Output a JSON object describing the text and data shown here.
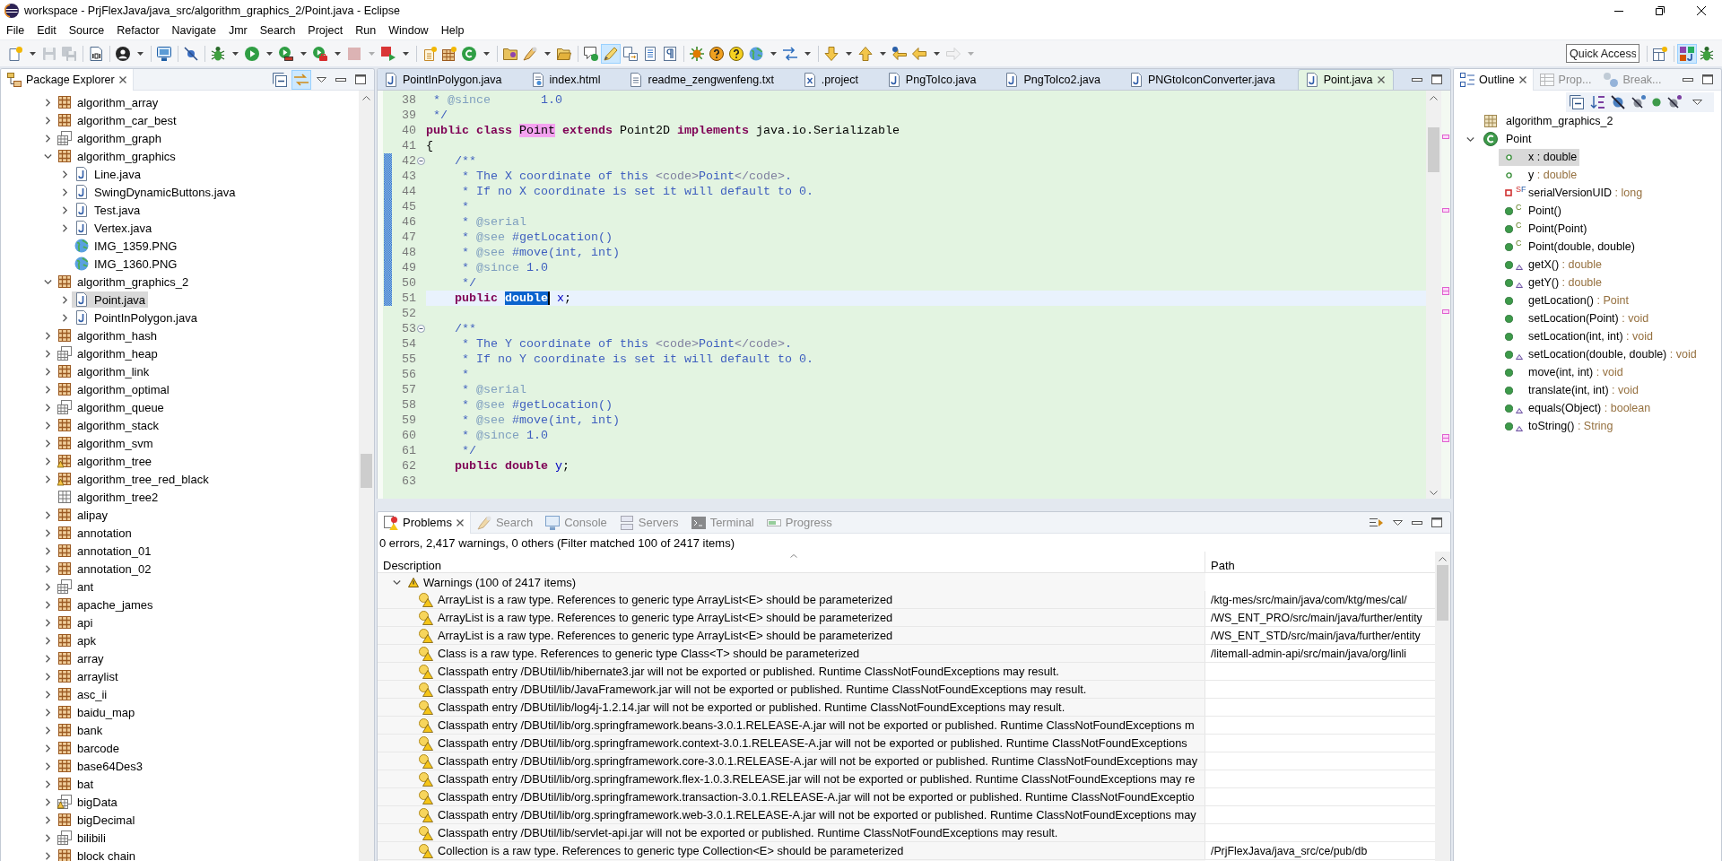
{
  "window": {
    "title": "workspace - PrjFlexJava/java_src/algorithm_graphics_2/Point.java - Eclipse"
  },
  "menu": [
    "File",
    "Edit",
    "Source",
    "Refactor",
    "Navigate",
    "Jmr",
    "Search",
    "Project",
    "Run",
    "Window",
    "Help"
  ],
  "toolbar": {
    "groups": [
      [
        {
          "kind": "new",
          "dropdown": true,
          "pressed": false,
          "disabled": false
        },
        {
          "kind": "save",
          "dropdown": false,
          "pressed": false,
          "disabled": true
        },
        {
          "kind": "save-all",
          "dropdown": false,
          "pressed": false,
          "disabled": true
        }
      ],
      [
        {
          "kind": "binary",
          "dropdown": false,
          "pressed": false,
          "disabled": false
        }
      ],
      [
        {
          "kind": "user",
          "dropdown": true,
          "pressed": false,
          "disabled": false
        }
      ],
      [
        {
          "kind": "monitor",
          "dropdown": false,
          "pressed": false,
          "disabled": false
        }
      ],
      [
        {
          "kind": "skip",
          "dropdown": false,
          "pressed": false,
          "disabled": false
        }
      ],
      [
        {
          "kind": "debug",
          "dropdown": true,
          "pressed": false,
          "disabled": false
        },
        {
          "kind": "run",
          "dropdown": true,
          "pressed": false,
          "disabled": false
        },
        {
          "kind": "coverage",
          "dropdown": true,
          "pressed": false,
          "disabled": false
        },
        {
          "kind": "tools",
          "dropdown": true,
          "pressed": false,
          "disabled": false
        },
        {
          "kind": "stop",
          "dropdown": true,
          "pressed": false,
          "disabled": true
        },
        {
          "kind": "launch",
          "dropdown": true,
          "pressed": false,
          "disabled": false
        }
      ],
      [
        {
          "kind": "new-project",
          "dropdown": false,
          "pressed": false,
          "disabled": false
        },
        {
          "kind": "package",
          "dropdown": false,
          "pressed": false,
          "disabled": false
        },
        {
          "kind": "new-class",
          "dropdown": true,
          "pressed": false,
          "disabled": false
        }
      ],
      [
        {
          "kind": "open-type",
          "dropdown": false,
          "pressed": false,
          "disabled": false
        },
        {
          "kind": "search-pen",
          "dropdown": true,
          "pressed": false,
          "disabled": false
        },
        {
          "kind": "open-folder",
          "dropdown": false,
          "pressed": false,
          "disabled": false
        }
      ],
      [
        {
          "kind": "annotation",
          "dropdown": false,
          "pressed": false,
          "disabled": false
        },
        {
          "kind": "highlight",
          "dropdown": false,
          "pressed": true,
          "disabled": false
        },
        {
          "kind": "doc-arrow",
          "dropdown": false,
          "pressed": false,
          "disabled": false
        },
        {
          "kind": "doc-lines",
          "dropdown": false,
          "pressed": false,
          "disabled": false
        },
        {
          "kind": "pilcrow",
          "dropdown": false,
          "pressed": false,
          "disabled": false
        }
      ],
      [
        {
          "kind": "gear",
          "dropdown": false,
          "pressed": false,
          "disabled": false
        },
        {
          "kind": "help-orange",
          "dropdown": false,
          "pressed": false,
          "disabled": false
        },
        {
          "kind": "help-yellow",
          "dropdown": false,
          "pressed": false,
          "disabled": false
        },
        {
          "kind": "globe",
          "dropdown": true,
          "pressed": false,
          "disabled": false
        },
        {
          "kind": "sync",
          "dropdown": true,
          "pressed": false,
          "disabled": false
        }
      ],
      [
        {
          "kind": "next-annotation",
          "dropdown": true,
          "pressed": false,
          "disabled": false
        },
        {
          "kind": "prev-annotation",
          "dropdown": true,
          "pressed": false,
          "disabled": false
        },
        {
          "kind": "last-edit",
          "dropdown": false,
          "pressed": false,
          "disabled": false
        },
        {
          "kind": "back",
          "dropdown": true,
          "pressed": false,
          "disabled": false
        },
        {
          "kind": "forward",
          "dropdown": true,
          "pressed": false,
          "disabled": true
        }
      ]
    ],
    "quick_access": {
      "placeholder": "Quick Access"
    },
    "perspectives": [
      {
        "kind": "java",
        "selected": true
      },
      {
        "kind": "debug",
        "selected": false
      }
    ]
  },
  "package_explorer": {
    "title": "Package Explorer",
    "view_tools": [
      {
        "kind": "collapse-all",
        "pressed": false
      },
      {
        "kind": "link",
        "pressed": true
      }
    ],
    "items": [
      {
        "label": "algorithm_array",
        "kind": "package",
        "warning": false,
        "expanded": false,
        "selected": false
      },
      {
        "label": "algorithm_car_best",
        "kind": "package",
        "warning": false,
        "expanded": false,
        "selected": false
      },
      {
        "label": "algorithm_graph",
        "kind": "package-hollow",
        "warning": false,
        "expanded": false,
        "selected": false
      },
      {
        "label": "algorithm_graphics",
        "kind": "package",
        "warning": false,
        "expanded": true,
        "selected": false,
        "children": [
          {
            "label": "Line.java",
            "kind": "java-file",
            "warning": false,
            "expanded": false,
            "selected": false
          },
          {
            "label": "SwingDynamicButtons.java",
            "kind": "java-file",
            "warning": false,
            "expanded": false,
            "selected": false
          },
          {
            "label": "Test.java",
            "kind": "java-file",
            "warning": false,
            "expanded": false,
            "selected": false
          },
          {
            "label": "Vertex.java",
            "kind": "java-file",
            "warning": false,
            "expanded": false,
            "selected": false
          },
          {
            "label": "IMG_1359.PNG",
            "kind": "image-file",
            "warning": false,
            "selected": false
          },
          {
            "label": "IMG_1360.PNG",
            "kind": "image-file",
            "warning": false,
            "selected": false
          }
        ]
      },
      {
        "label": "algorithm_graphics_2",
        "kind": "package",
        "warning": false,
        "expanded": true,
        "selected": false,
        "children": [
          {
            "label": "Point.java",
            "kind": "java-file",
            "warning": false,
            "expanded": false,
            "selected": true
          },
          {
            "label": "PointInPolygon.java",
            "kind": "java-file",
            "warning": false,
            "expanded": false,
            "selected": false
          }
        ]
      },
      {
        "label": "algorithm_hash",
        "kind": "package",
        "warning": false,
        "expanded": false,
        "selected": false
      },
      {
        "label": "algorithm_heap",
        "kind": "package-hollow",
        "warning": false,
        "expanded": false,
        "selected": false
      },
      {
        "label": "algorithm_link",
        "kind": "package",
        "warning": false,
        "expanded": false,
        "selected": false
      },
      {
        "label": "algorithm_optimal",
        "kind": "package",
        "warning": false,
        "expanded": false,
        "selected": false
      },
      {
        "label": "algorithm_queue",
        "kind": "package-hollow",
        "warning": false,
        "expanded": false,
        "selected": false
      },
      {
        "label": "algorithm_stack",
        "kind": "package",
        "warning": false,
        "expanded": false,
        "selected": false
      },
      {
        "label": "algorithm_svm",
        "kind": "package",
        "warning": false,
        "expanded": false,
        "selected": false
      },
      {
        "label": "algorithm_tree",
        "kind": "package",
        "warning": true,
        "expanded": false,
        "selected": false
      },
      {
        "label": "algorithm_tree_red_black",
        "kind": "package",
        "warning": true,
        "expanded": false,
        "selected": false
      },
      {
        "label": "algorithm_tree2",
        "kind": "package-empty",
        "warning": false,
        "selected": false
      },
      {
        "label": "alipay",
        "kind": "package",
        "warning": false,
        "expanded": false,
        "selected": false
      },
      {
        "label": "annotation",
        "kind": "package",
        "warning": false,
        "expanded": false,
        "selected": false
      },
      {
        "label": "annotation_01",
        "kind": "package",
        "warning": false,
        "expanded": false,
        "selected": false
      },
      {
        "label": "annotation_02",
        "kind": "package",
        "warning": false,
        "expanded": false,
        "selected": false
      },
      {
        "label": "ant",
        "kind": "package-hollow",
        "warning": false,
        "expanded": false,
        "selected": false
      },
      {
        "label": "apache_james",
        "kind": "package",
        "warning": false,
        "expanded": false,
        "selected": false
      },
      {
        "label": "api",
        "kind": "package",
        "warning": false,
        "expanded": false,
        "selected": false
      },
      {
        "label": "apk",
        "kind": "package",
        "warning": false,
        "expanded": false,
        "selected": false
      },
      {
        "label": "array",
        "kind": "package",
        "warning": false,
        "expanded": false,
        "selected": false
      },
      {
        "label": "arraylist",
        "kind": "package",
        "warning": false,
        "expanded": false,
        "selected": false
      },
      {
        "label": "asc_ii",
        "kind": "package",
        "warning": false,
        "expanded": false,
        "selected": false
      },
      {
        "label": "baidu_map",
        "kind": "package",
        "warning": false,
        "expanded": false,
        "selected": false
      },
      {
        "label": "bank",
        "kind": "package",
        "warning": false,
        "expanded": false,
        "selected": false
      },
      {
        "label": "barcode",
        "kind": "package",
        "warning": false,
        "expanded": false,
        "selected": false
      },
      {
        "label": "base64Des3",
        "kind": "package",
        "warning": false,
        "expanded": false,
        "selected": false
      },
      {
        "label": "bat",
        "kind": "package",
        "warning": false,
        "expanded": false,
        "selected": false
      },
      {
        "label": "bigData",
        "kind": "package-hollow",
        "warning": true,
        "expanded": false,
        "selected": false
      },
      {
        "label": "bigDecimal",
        "kind": "package",
        "warning": false,
        "expanded": false,
        "selected": false
      },
      {
        "label": "bilibili",
        "kind": "package-hollow",
        "warning": false,
        "expanded": false,
        "selected": false
      },
      {
        "label": "block chain",
        "kind": "package",
        "warning": false,
        "expanded": false,
        "selected": false
      }
    ]
  },
  "editor": {
    "tabs": [
      {
        "label": "PointInPolygon.java",
        "kind": "java",
        "selected": false
      },
      {
        "label": "index.html",
        "kind": "html",
        "selected": false
      },
      {
        "label": "readme_zengwenfeng.txt",
        "kind": "text",
        "selected": false
      },
      {
        "label": ".project",
        "kind": "xml",
        "selected": false
      },
      {
        "label": "PngToIco.java",
        "kind": "java",
        "selected": false
      },
      {
        "label": "PngToIco2.java",
        "kind": "java",
        "selected": false
      },
      {
        "label": "PNGtoIconConverter.java",
        "kind": "java",
        "selected": false
      },
      {
        "label": "Point.java",
        "kind": "java",
        "selected": true
      }
    ],
    "lines": [
      {
        "number": "38",
        "range": false,
        "fold": false,
        "current": false,
        "tokens": [
          {
            "text": " * ",
            "kind": "doc"
          },
          {
            "text": "@since",
            "kind": "doc-tag"
          },
          {
            "text": "       1.0",
            "kind": "doc"
          }
        ]
      },
      {
        "number": "39",
        "range": false,
        "fold": false,
        "current": false,
        "tokens": [
          {
            "text": " */",
            "kind": "doc"
          }
        ]
      },
      {
        "number": "40",
        "range": false,
        "fold": false,
        "current": false,
        "tokens": [
          {
            "text": "public ",
            "kind": "keyword"
          },
          {
            "text": "class ",
            "kind": "keyword"
          },
          {
            "text": "Point",
            "kind": "occurrence"
          },
          {
            "text": " extends",
            "kind": "keyword"
          },
          {
            "text": " Point2D ",
            "kind": "plain"
          },
          {
            "text": "implements",
            "kind": "keyword"
          },
          {
            "text": " java.io.Serializable",
            "kind": "plain"
          }
        ]
      },
      {
        "number": "41",
        "range": false,
        "fold": false,
        "current": false,
        "tokens": [
          {
            "text": "{",
            "kind": "plain"
          }
        ]
      },
      {
        "number": "42",
        "range": true,
        "fold": true,
        "current": false,
        "tokens": [
          {
            "text": "    /**",
            "kind": "doc"
          }
        ]
      },
      {
        "number": "43",
        "range": true,
        "fold": false,
        "current": false,
        "tokens": [
          {
            "text": "     * The X coordinate of this ",
            "kind": "doc"
          },
          {
            "text": "<code>",
            "kind": "doc-html"
          },
          {
            "text": "Point",
            "kind": "doc"
          },
          {
            "text": "</code>",
            "kind": "doc-html"
          },
          {
            "text": ".",
            "kind": "doc"
          }
        ]
      },
      {
        "number": "44",
        "range": true,
        "fold": false,
        "current": false,
        "tokens": [
          {
            "text": "     * If no X coordinate is set it will default to 0.",
            "kind": "doc"
          }
        ]
      },
      {
        "number": "45",
        "range": true,
        "fold": false,
        "current": false,
        "tokens": [
          {
            "text": "     *",
            "kind": "doc"
          }
        ]
      },
      {
        "number": "46",
        "range": true,
        "fold": false,
        "current": false,
        "tokens": [
          {
            "text": "     * ",
            "kind": "doc"
          },
          {
            "text": "@serial",
            "kind": "doc-tag"
          }
        ]
      },
      {
        "number": "47",
        "range": true,
        "fold": false,
        "current": false,
        "tokens": [
          {
            "text": "     * ",
            "kind": "doc"
          },
          {
            "text": "@see",
            "kind": "doc-tag"
          },
          {
            "text": " #getLocation()",
            "kind": "doc"
          }
        ]
      },
      {
        "number": "48",
        "range": true,
        "fold": false,
        "current": false,
        "tokens": [
          {
            "text": "     * ",
            "kind": "doc"
          },
          {
            "text": "@see",
            "kind": "doc-tag"
          },
          {
            "text": " #move(int, int)",
            "kind": "doc"
          }
        ]
      },
      {
        "number": "49",
        "range": true,
        "fold": false,
        "current": false,
        "tokens": [
          {
            "text": "     * ",
            "kind": "doc"
          },
          {
            "text": "@since",
            "kind": "doc-tag"
          },
          {
            "text": " 1.0",
            "kind": "doc"
          }
        ]
      },
      {
        "number": "50",
        "range": true,
        "fold": false,
        "current": false,
        "tokens": [
          {
            "text": "     */",
            "kind": "doc"
          }
        ]
      },
      {
        "number": "51",
        "range": true,
        "fold": false,
        "current": true,
        "tokens": [
          {
            "text": "    public ",
            "kind": "keyword"
          },
          {
            "text": "double",
            "kind": "selection"
          },
          {
            "text": " x",
            "kind": "field"
          },
          {
            "text": ";",
            "kind": "plain"
          }
        ]
      },
      {
        "number": "52",
        "range": false,
        "fold": false,
        "current": false
      },
      {
        "number": "53",
        "range": false,
        "fold": true,
        "current": false,
        "tokens": [
          {
            "text": "    /**",
            "kind": "doc"
          }
        ]
      },
      {
        "number": "54",
        "range": false,
        "fold": false,
        "current": false,
        "tokens": [
          {
            "text": "     * The Y coordinate of this ",
            "kind": "doc"
          },
          {
            "text": "<code>",
            "kind": "doc-html"
          },
          {
            "text": "Point",
            "kind": "doc"
          },
          {
            "text": "</code>",
            "kind": "doc-html"
          },
          {
            "text": ".",
            "kind": "doc"
          }
        ]
      },
      {
        "number": "55",
        "range": false,
        "fold": false,
        "current": false,
        "tokens": [
          {
            "text": "     * If no Y coordinate is set it will default to 0.",
            "kind": "doc"
          }
        ]
      },
      {
        "number": "56",
        "range": false,
        "fold": false,
        "current": false,
        "tokens": [
          {
            "text": "     *",
            "kind": "doc"
          }
        ]
      },
      {
        "number": "57",
        "range": false,
        "fold": false,
        "current": false,
        "tokens": [
          {
            "text": "     * ",
            "kind": "doc"
          },
          {
            "text": "@serial",
            "kind": "doc-tag"
          }
        ]
      },
      {
        "number": "58",
        "range": false,
        "fold": false,
        "current": false,
        "tokens": [
          {
            "text": "     * ",
            "kind": "doc"
          },
          {
            "text": "@see",
            "kind": "doc-tag"
          },
          {
            "text": " #getLocation()",
            "kind": "doc"
          }
        ]
      },
      {
        "number": "59",
        "range": false,
        "fold": false,
        "current": false,
        "tokens": [
          {
            "text": "     * ",
            "kind": "doc"
          },
          {
            "text": "@see",
            "kind": "doc-tag"
          },
          {
            "text": " #move(int, int)",
            "kind": "doc"
          }
        ]
      },
      {
        "number": "60",
        "range": false,
        "fold": false,
        "current": false,
        "tokens": [
          {
            "text": "     * ",
            "kind": "doc"
          },
          {
            "text": "@since",
            "kind": "doc-tag"
          },
          {
            "text": " 1.0",
            "kind": "doc"
          }
        ]
      },
      {
        "number": "61",
        "range": false,
        "fold": false,
        "current": false,
        "tokens": [
          {
            "text": "     */",
            "kind": "doc"
          }
        ]
      },
      {
        "number": "62",
        "range": false,
        "fold": false,
        "current": false,
        "tokens": [
          {
            "text": "    public double ",
            "kind": "keyword"
          },
          {
            "text": "y",
            "kind": "field"
          },
          {
            "text": ";",
            "kind": "plain"
          }
        ]
      },
      {
        "number": "63",
        "range": false,
        "fold": false,
        "current": false
      }
    ]
  },
  "outline": {
    "tabs": [
      {
        "label": "Outline",
        "kind": "outline",
        "selected": true
      },
      {
        "label": "Prop...",
        "kind": "properties",
        "selected": false
      },
      {
        "label": "Break...",
        "kind": "breakpoints",
        "selected": false
      }
    ],
    "items": [
      {
        "label": "algorithm_graphics_2",
        "kind": "package",
        "selected": false
      },
      {
        "label": "Point",
        "kind": "class",
        "expanded": true,
        "selected": false,
        "children": [
          {
            "label": "x",
            "type": ": double",
            "kind": "field",
            "overrides": false,
            "selected": true
          },
          {
            "label": "y",
            "type": ": double",
            "kind": "field",
            "overrides": false,
            "selected": false
          },
          {
            "label": "serialVersionUID",
            "type": ": long",
            "kind": "constant",
            "decorators": [
              "S",
              "F"
            ],
            "overrides": false,
            "selected": false
          },
          {
            "label": "Point()",
            "kind": "constructor",
            "decorators": [
              "C"
            ],
            "overrides": false,
            "selected": false
          },
          {
            "label": "Point(Point)",
            "kind": "constructor",
            "decorators": [
              "C"
            ],
            "overrides": false,
            "selected": false
          },
          {
            "label": "Point(double, double)",
            "kind": "constructor",
            "decorators": [
              "C"
            ],
            "overrides": false,
            "selected": false
          },
          {
            "label": "getX()",
            "type": ": double",
            "kind": "method",
            "overrides": true,
            "selected": false
          },
          {
            "label": "getY()",
            "type": ": double",
            "kind": "method",
            "overrides": true,
            "selected": false
          },
          {
            "label": "getLocation()",
            "type": ": Point",
            "kind": "method",
            "overrides": false,
            "selected": false
          },
          {
            "label": "setLocation(Point)",
            "type": ": void",
            "kind": "method",
            "overrides": false,
            "selected": false
          },
          {
            "label": "setLocation(int, int)",
            "type": ": void",
            "kind": "method",
            "overrides": false,
            "selected": false
          },
          {
            "label": "setLocation(double, double)",
            "type": ": void",
            "kind": "method",
            "overrides": true,
            "selected": false
          },
          {
            "label": "move(int, int)",
            "type": ": void",
            "kind": "method",
            "overrides": false,
            "selected": false
          },
          {
            "label": "translate(int, int)",
            "type": ": void",
            "kind": "method",
            "overrides": false,
            "selected": false
          },
          {
            "label": "equals(Object)",
            "type": ": boolean",
            "kind": "method",
            "overrides": true,
            "selected": false
          },
          {
            "label": "toString()",
            "type": ": String",
            "kind": "method",
            "overrides": true,
            "selected": false
          }
        ]
      }
    ]
  },
  "problems": {
    "tabs": [
      {
        "label": "Problems",
        "kind": "problems",
        "selected": true
      },
      {
        "label": "Search",
        "kind": "search",
        "selected": false
      },
      {
        "label": "Console",
        "kind": "console",
        "selected": false
      },
      {
        "label": "Servers",
        "kind": "servers",
        "selected": false
      },
      {
        "label": "Terminal",
        "kind": "terminal",
        "selected": false
      },
      {
        "label": "Progress",
        "kind": "progress",
        "selected": false
      }
    ],
    "summary": "0 errors, 2,417 warnings, 0 others (Filter matched 100 of 2417 items)",
    "columns": [
      "Description",
      "Path"
    ],
    "groups": [
      {
        "label": "Warnings (100 of 2417 items)",
        "expanded": true,
        "rows": [
          {
            "description": "ArrayList is a raw type. References to generic type ArrayList<E> should be parameterized",
            "path": "/ktg-mes/src/main/java/com/ktg/mes/cal/"
          },
          {
            "description": "ArrayList is a raw type. References to generic type ArrayList<E> should be parameterized",
            "path": "/WS_ENT_PRO/src/main/java/further/entity"
          },
          {
            "description": "ArrayList is a raw type. References to generic type ArrayList<E> should be parameterized",
            "path": "/WS_ENT_STD/src/main/java/further/entity"
          },
          {
            "description": "Class is a raw type. References to generic type Class<T> should be parameterized",
            "path": "/litemall-admin-api/src/main/java/org/linli"
          },
          {
            "description": "Classpath entry /DBUtil/lib/hibernate3.jar will not be exported or published. Runtime ClassNotFoundExceptions may result."
          },
          {
            "description": "Classpath entry /DBUtil/lib/JavaFramework.jar will not be exported or published. Runtime ClassNotFoundExceptions may result."
          },
          {
            "description": "Classpath entry /DBUtil/lib/log4j-1.2.14.jar will not be exported or published. Runtime ClassNotFoundExceptions may result."
          },
          {
            "description": "Classpath entry /DBUtil/lib/org.springframework.beans-3.0.1.RELEASE-A.jar will not be exported or published. Runtime ClassNotFoundExceptions m"
          },
          {
            "description": "Classpath entry /DBUtil/lib/org.springframework.context-3.0.1.RELEASE-A.jar will not be exported or published. Runtime ClassNotFoundExceptions"
          },
          {
            "description": "Classpath entry /DBUtil/lib/org.springframework.core-3.0.1.RELEASE-A.jar will not be exported or published. Runtime ClassNotFoundExceptions may"
          },
          {
            "description": "Classpath entry /DBUtil/lib/org.springframework.flex-1.0.3.RELEASE.jar will not be exported or published. Runtime ClassNotFoundExceptions may re"
          },
          {
            "description": "Classpath entry /DBUtil/lib/org.springframework.transaction-3.0.1.RELEASE-A.jar will not be exported or published. Runtime ClassNotFoundExceptio"
          },
          {
            "description": "Classpath entry /DBUtil/lib/org.springframework.web-3.0.1.RELEASE-A.jar will not be exported or published. Runtime ClassNotFoundExceptions may"
          },
          {
            "description": "Classpath entry /DBUtil/lib/servlet-api.jar will not be exported or published. Runtime ClassNotFoundExceptions may result."
          },
          {
            "description": "Collection is a raw type. References to generic type Collection<E> should be parameterized",
            "path": "/PrjFlexJava/java_src/ce/pub/db"
          }
        ]
      }
    ]
  }
}
